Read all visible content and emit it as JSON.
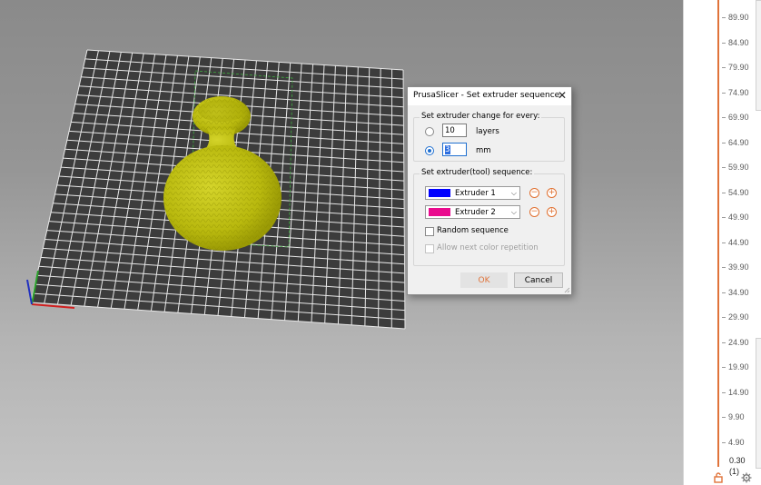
{
  "dialog": {
    "title": "PrusaSlicer - Set extruder sequence",
    "change_group": {
      "legend": "Set extruder change for every:",
      "options": [
        {
          "value": "10",
          "unit": "layers",
          "selected": false
        },
        {
          "value": "3",
          "unit": "mm",
          "selected": true
        }
      ]
    },
    "sequence_group": {
      "legend": "Set extruder(tool) sequence:",
      "extruders": [
        {
          "label": "Extruder 1",
          "color": "#0000ff"
        },
        {
          "label": "Extruder 2",
          "color": "#ea0a8e"
        }
      ],
      "random_label": "Random sequence",
      "repeat_label": "Allow next color repetition"
    },
    "ok_label": "OK",
    "cancel_label": "Cancel"
  },
  "layer_slider": {
    "ticks": [
      "89.90",
      "84.90",
      "79.90",
      "74.90",
      "69.90",
      "64.90",
      "59.90",
      "54.90",
      "49.90",
      "44.90",
      "39.90",
      "34.90",
      "29.90",
      "24.90",
      "19.90",
      "14.90",
      "9.90",
      "4.90"
    ],
    "bottom_value": "0.30",
    "bottom_index": "(1)",
    "accent": "#e0733a"
  },
  "scene": {
    "model_color": "#c8c814",
    "bed_color": "#3c3c3c"
  }
}
